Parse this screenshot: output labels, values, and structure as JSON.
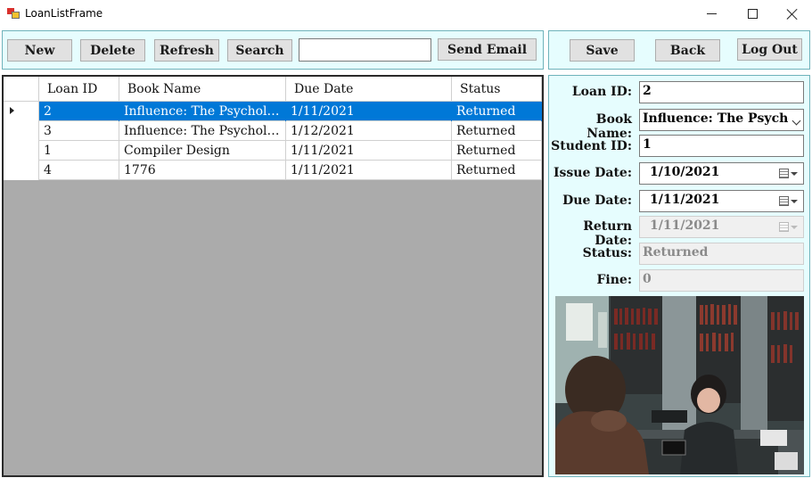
{
  "window": {
    "title": "LoanListFrame"
  },
  "toolbar": {
    "new_label": "New",
    "delete_label": "Delete",
    "refresh_label": "Refresh",
    "search_label": "Search",
    "search_value": "",
    "send_email_label": "Send Email",
    "save_label": "Save",
    "back_label": "Back",
    "logout_label": "Log Out"
  },
  "grid": {
    "columns": [
      "Loan ID",
      "Book Name",
      "Due Date",
      "Status"
    ],
    "rows": [
      {
        "loan_id": "2",
        "book_name": "Influence: The Psycholo...",
        "due_date": "1/11/2021",
        "status": "Returned",
        "selected": true
      },
      {
        "loan_id": "3",
        "book_name": "Influence: The Psycholo...",
        "due_date": "1/12/2021",
        "status": "Returned",
        "selected": false
      },
      {
        "loan_id": "1",
        "book_name": "Compiler Design",
        "due_date": "1/11/2021",
        "status": "Returned",
        "selected": false
      },
      {
        "loan_id": "4",
        "book_name": "1776",
        "due_date": "1/11/2021",
        "status": "Returned",
        "selected": false
      }
    ]
  },
  "detail": {
    "loan_id_label": "Loan ID:",
    "loan_id_value": "2",
    "book_name_label": "Book Name:",
    "book_name_value": "Influence: The Psycho",
    "student_id_label": "Student ID:",
    "student_id_value": "1",
    "issue_date_label": "Issue Date:",
    "issue_date_value": "1/10/2021",
    "due_date_label": "Due Date:",
    "due_date_value": "1/11/2021",
    "return_date_label": "Return Date:",
    "return_date_value": "1/11/2021",
    "status_label": "Status:",
    "status_value": "Returned",
    "fine_label": "Fine:",
    "fine_value": "0"
  },
  "colors": {
    "panel_bg": "#e6fdfe",
    "selection": "#0078d7",
    "grid_bg": "#ababab"
  },
  "icons": [
    "app-icon",
    "minimize-icon",
    "maximize-icon",
    "close-icon",
    "row-selector-icon",
    "dropdown-arrow-icon",
    "calendar-icon"
  ]
}
